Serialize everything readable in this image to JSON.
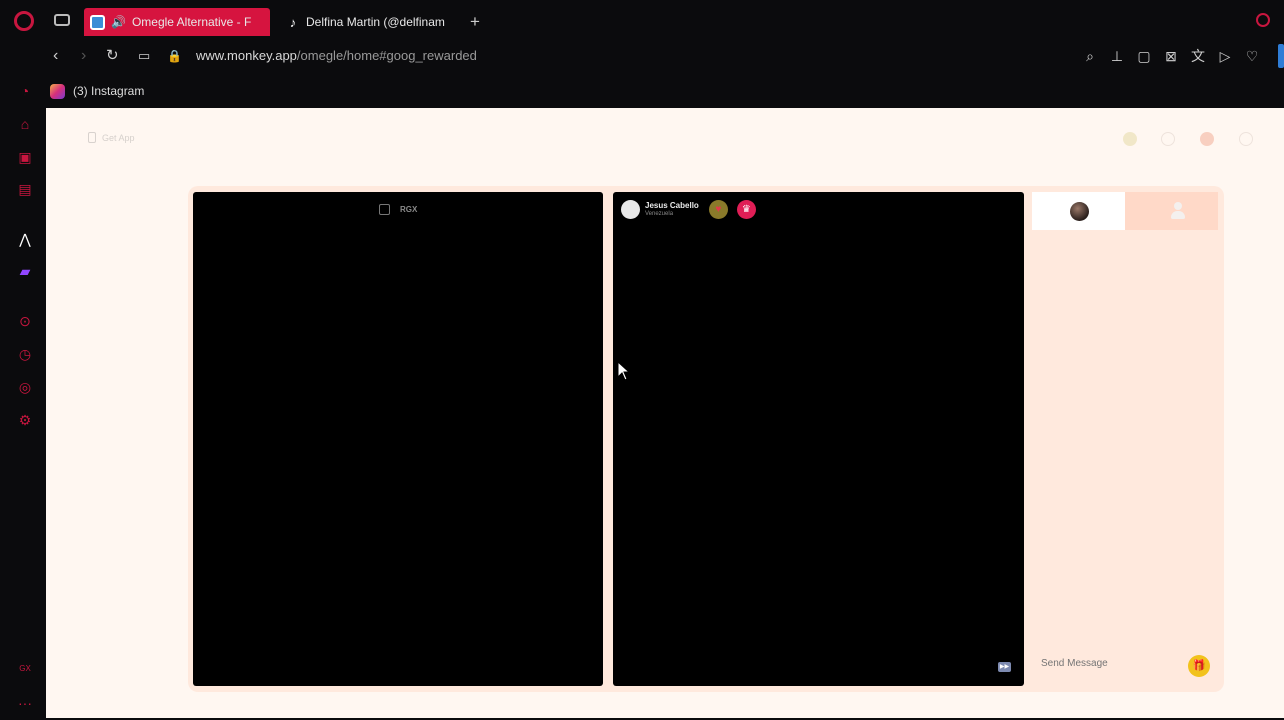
{
  "browser": {
    "tabs": [
      {
        "title": "Omegle Alternative - F",
        "active": true,
        "favicon": "monkey-favicon",
        "audio": true
      },
      {
        "title": "Delfina Martin (@delfinam",
        "active": false,
        "favicon": "tiktok-favicon"
      }
    ],
    "new_tab": "+",
    "url_host": "www.monkey.app",
    "url_path": "/omegle/home#goog_rewarded",
    "bookmarks": [
      {
        "label": "(3) Instagram",
        "icon": "instagram-icon"
      }
    ],
    "accent": "#d6143f"
  },
  "sidebar": {
    "icons": [
      "opera-news-icon",
      "shopping-icon",
      "video-icon",
      "messenger-icon",
      "aria-icon",
      "twitch-icon",
      "player-icon",
      "history-icon",
      "feed-icon",
      "settings-icon",
      "gx-icon",
      "more-icon"
    ]
  },
  "page": {
    "get_app": "Get App",
    "header_icons": [
      "diamond-icon",
      "search-icon",
      "coin-icon",
      "history-icon"
    ],
    "local_video": {
      "badge": "RGX"
    },
    "remote_video": {
      "peer_name": "Jesus Cabello",
      "peer_country": "Venezuela"
    },
    "chat": {
      "placeholder": "Send Message"
    }
  }
}
